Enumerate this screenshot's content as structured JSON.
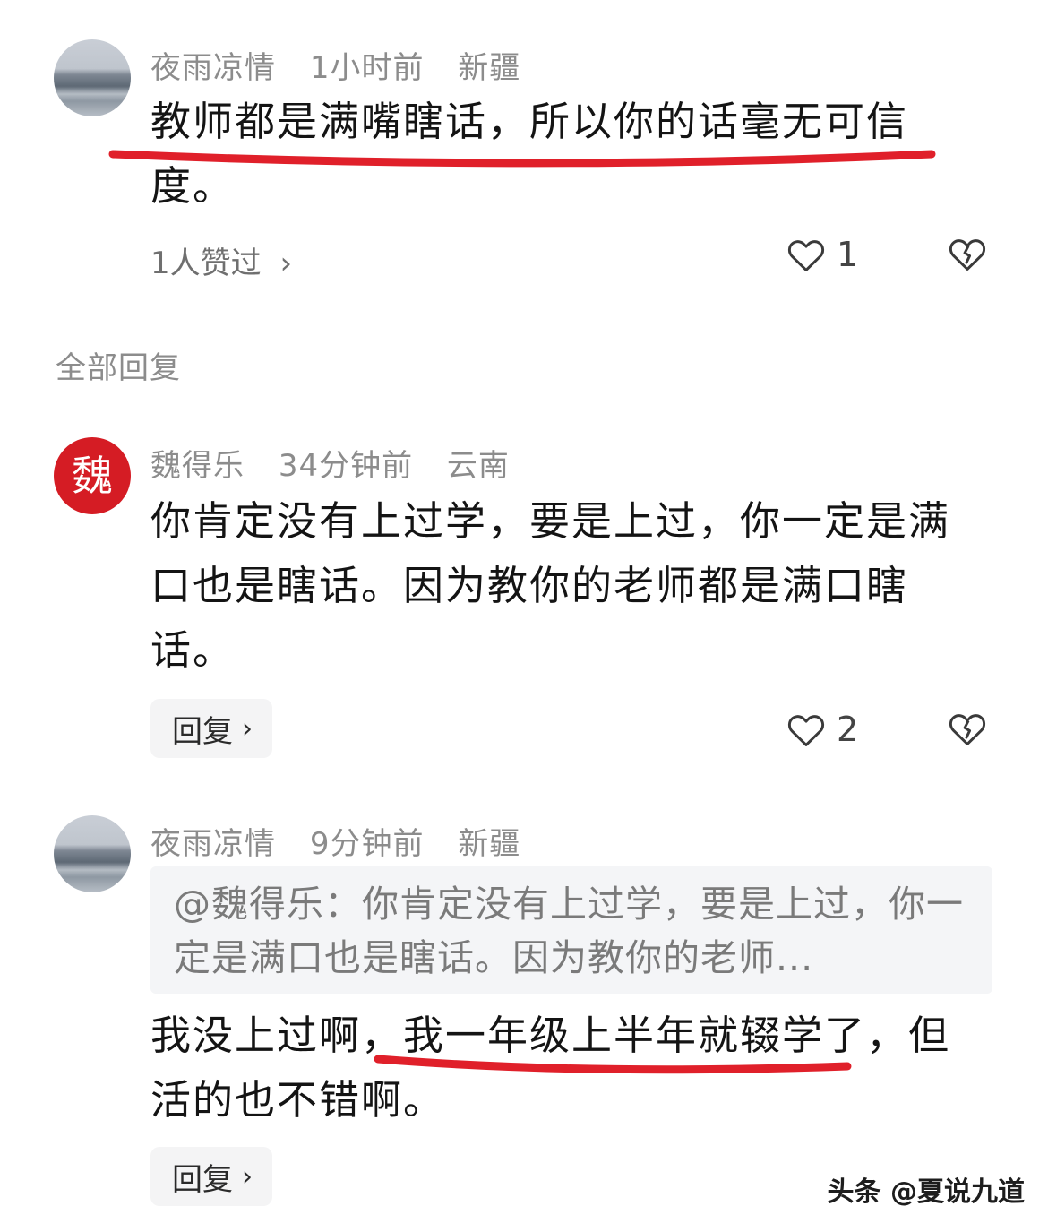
{
  "comment": {
    "user": "夜雨凉情",
    "time": "1小时前",
    "location": "新疆",
    "text": "教师都是满嘴瞎话，所以你的话毫无可信度。",
    "likes_summary": "1人赞过",
    "like_count": "1"
  },
  "replies_header": "全部回复",
  "replies": [
    {
      "user": "魏得乐",
      "time": "34分钟前",
      "location": "云南",
      "text": "你肯定没有上过学，要是上过，你一定是满口也是瞎话。因为教你的老师都是满口瞎话。",
      "like_count": "2",
      "reply_label": "回复",
      "avatar_glyph": "魏"
    },
    {
      "user": "夜雨凉情",
      "time": "9分钟前",
      "location": "新疆",
      "quote": "@魏得乐：你肯定没有上过学，要是上过，你一定是满口也是瞎话。因为教你的老师...",
      "text": "我没上过啊，我一年级上半年就辍学了，但活的也不错啊。",
      "reply_label": "回复"
    }
  ],
  "watermark": "头条 @夏说九道",
  "icons": {
    "like": "heart-outline-icon",
    "dislike": "broken-heart-icon",
    "chevron": "chevron-right-icon"
  },
  "colors": {
    "underline": "#e0202a",
    "meta": "#8c8c8c",
    "seal": "#d51c24"
  }
}
